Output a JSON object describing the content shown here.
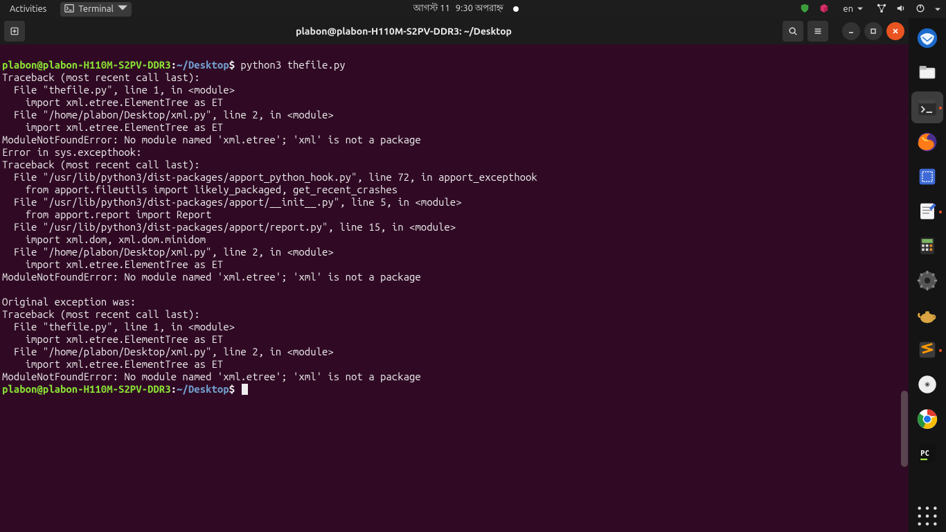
{
  "topbar": {
    "activities": "Activities",
    "app_label": "Terminal",
    "date": "আগস্ট 11",
    "time": "9:30 অপরাহ্ন",
    "lang": "en"
  },
  "window": {
    "title": "plabon@plabon-H110M-S2PV-DDR3: ~/Desktop"
  },
  "prompt": {
    "user_host": "plabon@plabon-H110M-S2PV-DDR3",
    "colon": ":",
    "path": "~/Desktop",
    "dollar": "$"
  },
  "commands": {
    "cmd1": " python3 thefile.py",
    "cmd2": " "
  },
  "out": {
    "l01": "Traceback (most recent call last):",
    "l02": "  File \"thefile.py\", line 1, in <module>",
    "l03": "    import xml.etree.ElementTree as ET",
    "l04": "  File \"/home/plabon/Desktop/xml.py\", line 2, in <module>",
    "l05": "    import xml.etree.ElementTree as ET",
    "l06": "ModuleNotFoundError: No module named 'xml.etree'; 'xml' is not a package",
    "l07": "Error in sys.excepthook:",
    "l08": "Traceback (most recent call last):",
    "l09": "  File \"/usr/lib/python3/dist-packages/apport_python_hook.py\", line 72, in apport_excepthook",
    "l10": "    from apport.fileutils import likely_packaged, get_recent_crashes",
    "l11": "  File \"/usr/lib/python3/dist-packages/apport/__init__.py\", line 5, in <module>",
    "l12": "    from apport.report import Report",
    "l13": "  File \"/usr/lib/python3/dist-packages/apport/report.py\", line 15, in <module>",
    "l14": "    import xml.dom, xml.dom.minidom",
    "l15": "  File \"/home/plabon/Desktop/xml.py\", line 2, in <module>",
    "l16": "    import xml.etree.ElementTree as ET",
    "l17": "ModuleNotFoundError: No module named 'xml.etree'; 'xml' is not a package",
    "l18": "",
    "l19": "Original exception was:",
    "l20": "Traceback (most recent call last):",
    "l21": "  File \"thefile.py\", line 1, in <module>",
    "l22": "    import xml.etree.ElementTree as ET",
    "l23": "  File \"/home/plabon/Desktop/xml.py\", line 2, in <module>",
    "l24": "    import xml.etree.ElementTree as ET",
    "l25": "ModuleNotFoundError: No module named 'xml.etree'; 'xml' is not a package"
  }
}
